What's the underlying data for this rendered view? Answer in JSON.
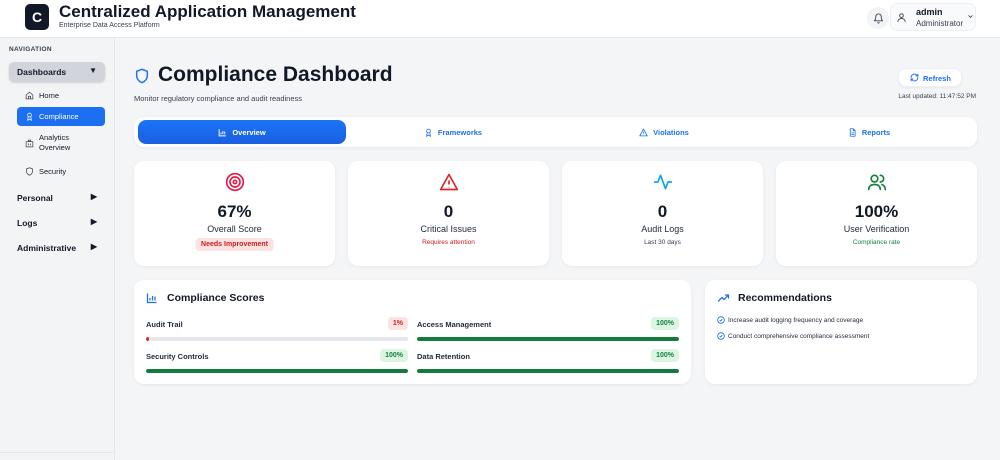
{
  "header": {
    "logo_letter": "C",
    "title": "Centralized Application Management",
    "subtitle": "Enterprise Data Access Platform",
    "user_name": "admin",
    "user_role": "Administrator"
  },
  "sidebar": {
    "heading": "NAVIGATION",
    "groups": [
      {
        "label": "Dashboards",
        "arrow": "▼"
      },
      {
        "label": "Personal",
        "arrow": "▶"
      },
      {
        "label": "Logs",
        "arrow": "▶"
      },
      {
        "label": "Administrative",
        "arrow": "▶"
      }
    ],
    "items": [
      {
        "label": "Home",
        "icon": "home-icon"
      },
      {
        "label": "Compliance",
        "icon": "award-icon"
      },
      {
        "label": "Analytics Overview",
        "icon": "building-icon"
      },
      {
        "label": "Security",
        "icon": "shield-icon"
      }
    ]
  },
  "page": {
    "title": "Compliance Dashboard",
    "subtitle": "Monitor regulatory compliance and audit readiness",
    "refresh_label": "Refresh",
    "last_updated": "Last updated: 11:47:52 PM"
  },
  "tabs": [
    {
      "label": "Overview",
      "icon": "bar-chart-icon"
    },
    {
      "label": "Frameworks",
      "icon": "award-icon"
    },
    {
      "label": "Violations",
      "icon": "warning-icon"
    },
    {
      "label": "Reports",
      "icon": "document-icon"
    }
  ],
  "stats": [
    {
      "value": "67%",
      "label": "Overall Score",
      "sub": "Needs Improvement",
      "icon": "target-icon"
    },
    {
      "value": "0",
      "label": "Critical Issues",
      "sub": "Requires attention",
      "icon": "warning-icon"
    },
    {
      "value": "0",
      "label": "Audit Logs",
      "sub": "Last 30 days",
      "icon": "activity-icon"
    },
    {
      "value": "100%",
      "label": "User Verification",
      "sub": "Compliance rate",
      "icon": "users-icon"
    }
  ],
  "scores": {
    "title": "Compliance Scores",
    "items": [
      {
        "label": "Audit Trail",
        "badge": "1%",
        "percent": 1
      },
      {
        "label": "Access Management",
        "badge": "100%",
        "percent": 100
      },
      {
        "label": "Security Controls",
        "badge": "100%",
        "percent": 100
      },
      {
        "label": "Data Retention",
        "badge": "100%",
        "percent": 100
      }
    ]
  },
  "recommendations": {
    "title": "Recommendations",
    "items": [
      "Increase audit logging frequency and coverage",
      "Conduct comprehensive compliance assessment"
    ]
  },
  "colors": {
    "accent": "#1d6ff2",
    "danger": "#c81e1e",
    "success": "#15803d",
    "activity": "#0ea5e9"
  }
}
